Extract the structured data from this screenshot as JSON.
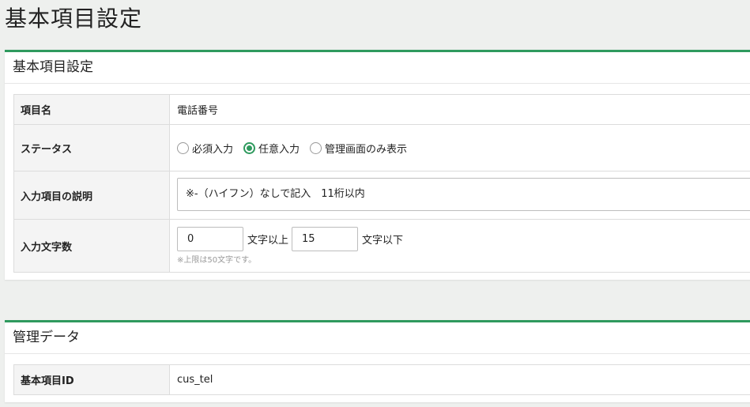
{
  "page": {
    "title": "基本項目設定"
  },
  "section_basic": {
    "title": "基本項目設定",
    "rows": {
      "name": {
        "label": "項目名",
        "value": "電話番号"
      },
      "status": {
        "label": "ステータス",
        "options": [
          "必須入力",
          "任意入力",
          "管理画面のみ表示"
        ],
        "selected": "任意入力"
      },
      "description": {
        "label": "入力項目の説明",
        "value": "※-（ハイフン）なしで記入　11桁以内"
      },
      "length": {
        "label": "入力文字数",
        "min_value": "0",
        "min_suffix": "文字以上",
        "max_value": "15",
        "max_suffix": "文字以下",
        "note": "※上限は50文字です。"
      }
    }
  },
  "section_admin": {
    "title": "管理データ",
    "rows": {
      "id": {
        "label": "基本項目ID",
        "value": "cus_tel"
      }
    }
  },
  "colors": {
    "accent": "#2f9a5e"
  }
}
